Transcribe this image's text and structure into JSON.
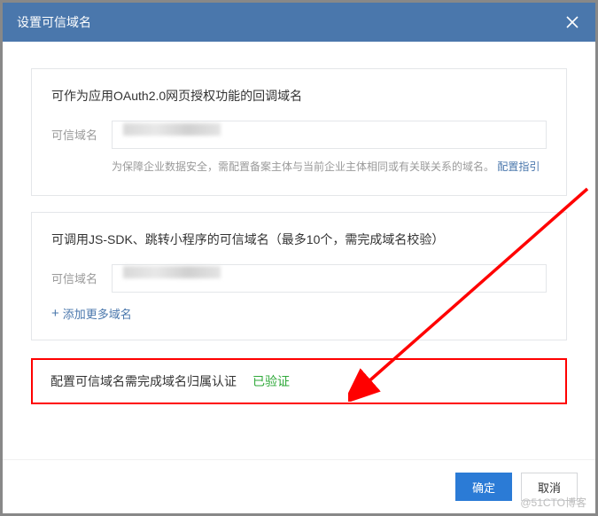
{
  "dialog": {
    "title": "设置可信域名"
  },
  "section1": {
    "title": "可作为应用OAuth2.0网页授权功能的回调域名",
    "label": "可信域名",
    "hint_prefix": "为保障企业数据安全，需配置备案主体与当前企业主体相同或有关联关系的域名。",
    "hint_link": "配置指引"
  },
  "section2": {
    "title": "可调用JS-SDK、跳转小程序的可信域名（最多10个，需完成域名校验）",
    "label": "可信域名",
    "add_more": "添加更多域名"
  },
  "verify": {
    "text": "配置可信域名需完成域名归属认证",
    "status": "已验证"
  },
  "footer": {
    "confirm": "确定",
    "cancel": "取消"
  },
  "watermark": "@51CTO博客"
}
